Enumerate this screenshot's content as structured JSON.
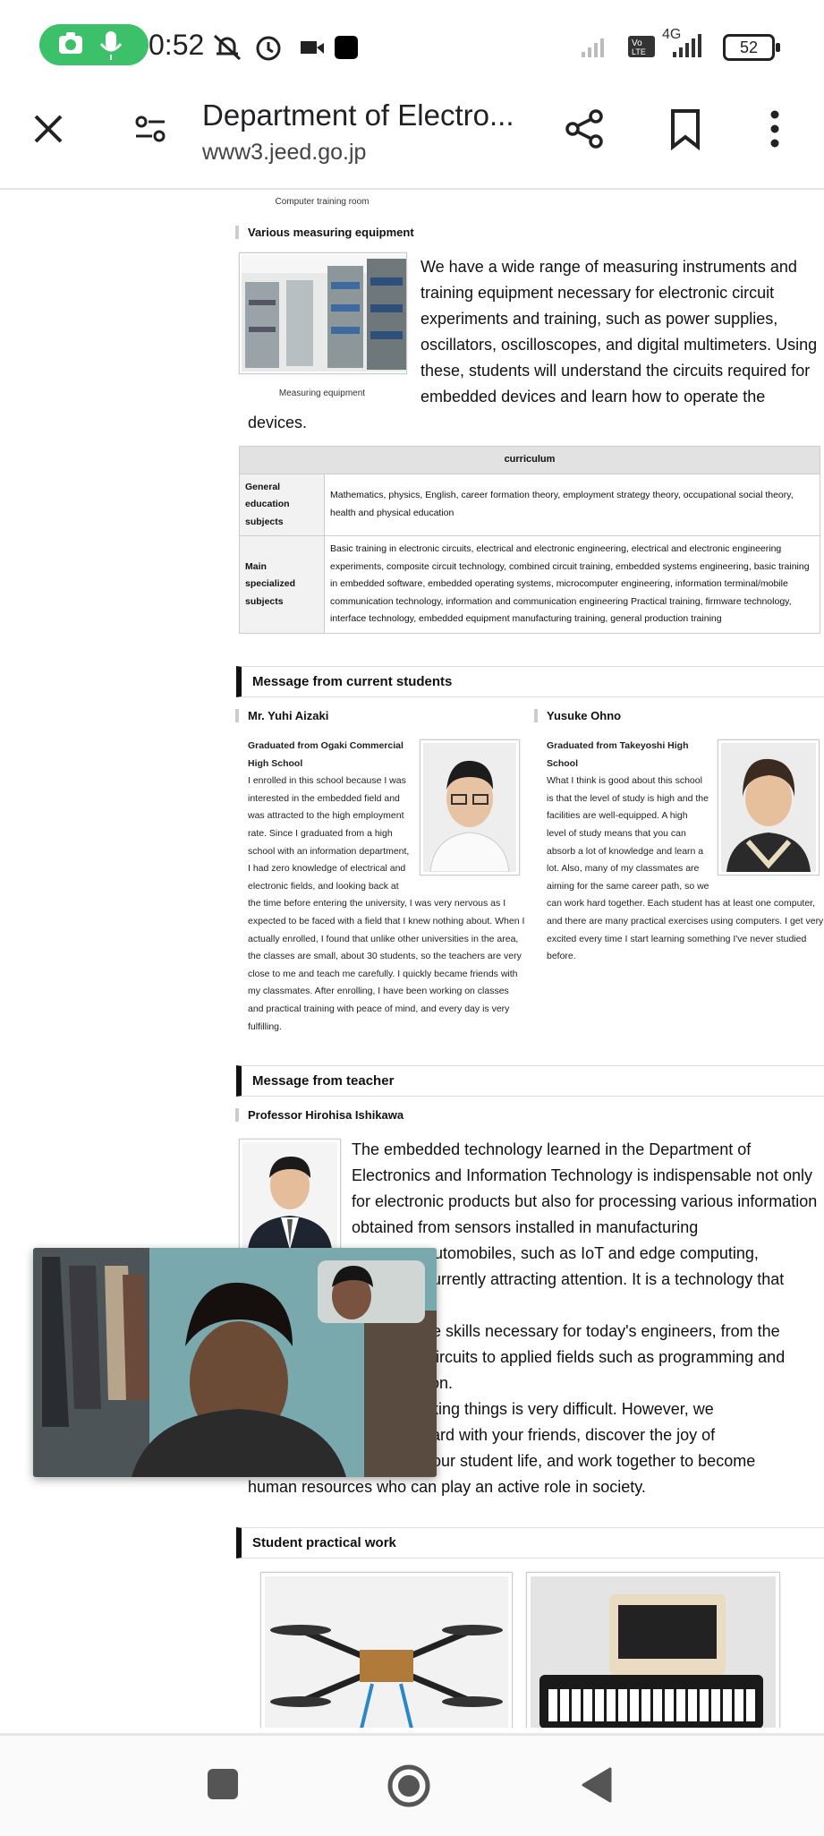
{
  "status_bar": {
    "time": "0:52",
    "network": "4G",
    "volte": "Vo LTE",
    "battery": "52"
  },
  "toolbar": {
    "title": "Department of Electro...",
    "url": "www3.jeed.go.jp"
  },
  "page": {
    "computer_room_caption": "Computer training room",
    "measuring_heading": "Various measuring equipment",
    "measuring_caption": "Measuring equipment",
    "measuring_text": "We have a wide range of measuring instruments and training equipment necessary for electronic circuit experiments and training, such as power supplies, oscillators, oscilloscopes, and digital multimeters. Using these, students will understand the circuits required for embedded devices and learn how to operate the devices.",
    "curriculum": {
      "header": "curriculum",
      "rows": [
        {
          "label": "General education subjects",
          "value": "Mathematics, physics, English, career formation theory, employment strategy theory, occupational social theory, health and physical education"
        },
        {
          "label": "Main specialized subjects",
          "value": "Basic training in electronic circuits, electrical and electronic engineering, electrical and electronic engineering experiments, composite circuit technology, combined circuit training, embedded systems engineering, basic training in embedded software, embedded operating systems, microcomputer engineering, information terminal/mobile communication technology, information and communication engineering Practical training, firmware technology, interface technology, embedded equipment manufacturing training, general production training"
        }
      ]
    },
    "students_heading": "Message from current students",
    "student1": {
      "name": "Mr. Yuhi Aizaki",
      "school": "Graduated from Ogaki Commercial High School",
      "text": "I enrolled in this school because I was interested in the embedded field and was attracted to the high employment rate. Since I graduated from a high school with an information department, I had zero knowledge of electrical and electronic fields, and looking back at the time before entering the university, I was very nervous as I expected to be faced with a field that I knew nothing about. When I actually enrolled, I found that unlike other universities in the area, the classes are small, about 30 students, so the teachers are very close to me and teach me carefully. I quickly became friends with my classmates. After enrolling, I have been working on classes and practical training with peace of mind, and every day is very fulfilling."
    },
    "student2": {
      "name": "Yusuke Ohno",
      "school": "Graduated from Takeyoshi High School",
      "text": "What I think is good about this school is that the level of study is high and the facilities are well-equipped. A high level of study means that you can absorb a lot of knowledge and learn a lot. Also, many of my classmates are aiming for the same career path, so we can work hard together. Each student has at least one computer, and there are many practical exercises using computers. I get very excited every time I start learning something I've never studied before."
    },
    "teacher_heading": "Message from teacher",
    "teacher_name": "Professor Hirohisa Ishikawa",
    "teacher_text1": "The embedded technology learned in the Department of Electronics and Information Technology is indispensable not only for electronic products but also for processing various information obtained from sensors installed in manufacturing",
    "teacher_text2": "utomobiles, such as IoT and edge computing,",
    "teacher_text3": "urrently attracting attention. It is a technology that",
    "teacher_text4": "e skills necessary for today's engineers, from the",
    "teacher_text5": "circuits to applied fields such as programming and",
    "teacher_text6": "ion.",
    "teacher_text7": "king things is very difficult. However, we",
    "teacher_text8": "ard with your friends, discover the joy of",
    "teacher_text9": "our student life, and work together to become",
    "teacher_text10": "human resources who can play an active role in society.",
    "practical_heading": "Student practical work"
  }
}
